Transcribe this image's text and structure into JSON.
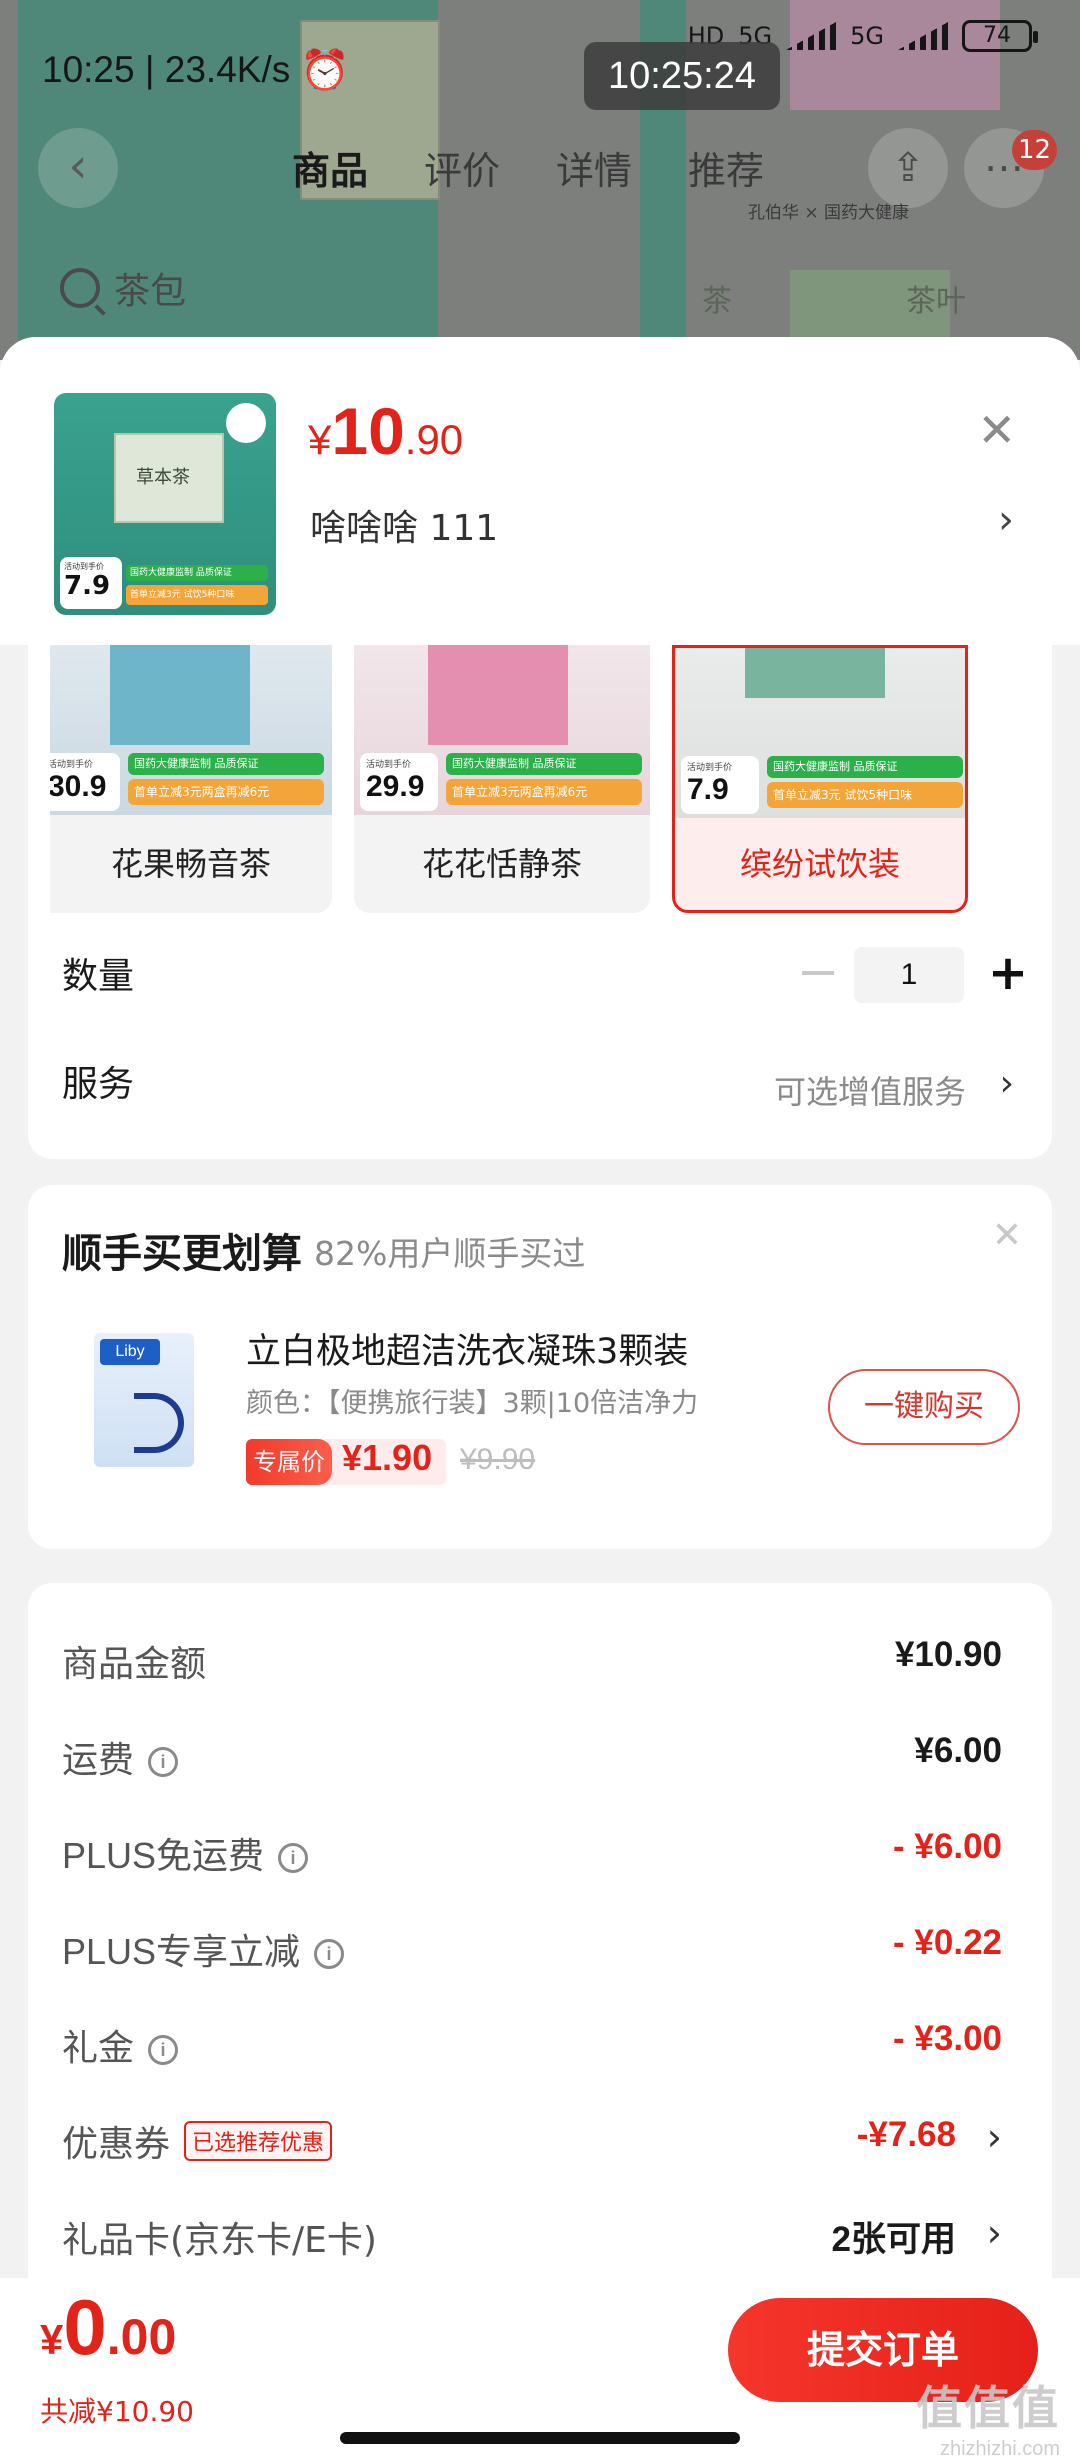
{
  "status_bar": {
    "time_speed": "10:25 | 23.4K/s",
    "overlay_time": "10:25:24",
    "net_label_1": "HD",
    "net_label_2": "5G",
    "net_label_3": "5G",
    "battery": "74"
  },
  "background_page": {
    "tabs": [
      "商品",
      "评价",
      "详情",
      "推荐"
    ],
    "active_tab_index": 0,
    "cart_badge": "12",
    "brand_text": "孔伯华 × 国药大健康",
    "search_text": "茶包",
    "category_1": "茶",
    "category_2": "茶叶"
  },
  "sheet": {
    "price": {
      "currency": "¥",
      "integer": "10",
      "decimal": ".90"
    },
    "selected_spec": "啥啥啥  111",
    "thumb": {
      "flag_label": "活动到手价",
      "flag_price": "7.9",
      "strip_top": "国药大健康监制 品质保证",
      "strip_bottom": "首单立减3元 试饮5种口味"
    },
    "variants": [
      {
        "label": "花果畅音茶",
        "flag_label": "活动到手价",
        "flag_price": "30.9",
        "strip_top": "国药大健康监制 品质保证",
        "strip_bottom": "首单立减3元两盒再减6元",
        "selected": false
      },
      {
        "label": "花花恬静茶",
        "flag_label": "活动到手价",
        "flag_price": "29.9",
        "strip_top": "国药大健康监制 品质保证",
        "strip_bottom": "首单立减3元两盒再减6元",
        "selected": false
      },
      {
        "label": "缤纷试饮装",
        "flag_label": "活动到手价",
        "flag_price": "7.9",
        "strip_top": "国药大健康监制 品质保证",
        "strip_bottom": "首单立减3元 试饮5种口味",
        "selected": true
      }
    ],
    "quantity_label": "数量",
    "quantity_value": "1",
    "service_label": "服务",
    "service_value": "可选增值服务"
  },
  "addon": {
    "title": "顺手买更划算",
    "subtitle": "82%用户顺手买过",
    "product_name": "立白极地超洁洗衣凝珠3颗装",
    "product_spec": "颜色：【便携旅行装】3颗|10倍洁净力",
    "thumb_logo": "Liby",
    "tag": "专属价",
    "price": "¥1.90",
    "original_price": "¥9.90",
    "buy_button": "一键购买"
  },
  "summary": {
    "rows": [
      {
        "label": "商品金额",
        "value": "¥10.90",
        "info": false,
        "red": false
      },
      {
        "label": "运费",
        "value": "¥6.00",
        "info": true,
        "red": false
      },
      {
        "label": "PLUS免运费",
        "value": "- ¥6.00",
        "info": true,
        "red": true
      },
      {
        "label": "PLUS专享立减",
        "value": "- ¥0.22",
        "info": true,
        "red": true
      },
      {
        "label": "礼金",
        "value": "- ¥3.00",
        "info": true,
        "red": true
      },
      {
        "label": "优惠券",
        "value": "-¥7.68",
        "badge": "已选推荐优惠",
        "red": true,
        "chevron": true
      },
      {
        "label": "礼品卡(京东卡/E卡)",
        "value": "2张可用",
        "red": false,
        "chevron": true
      }
    ]
  },
  "bottom_bar": {
    "total": {
      "currency": "¥",
      "integer": "0",
      "decimal": ".00"
    },
    "saved": "共减¥10.90",
    "submit": "提交订单"
  },
  "watermark": {
    "logo": "值值值",
    "url": "zhizhizhi.com"
  },
  "colors": {
    "accent_red": "#e2231a",
    "teal": "#2f8e7d"
  }
}
